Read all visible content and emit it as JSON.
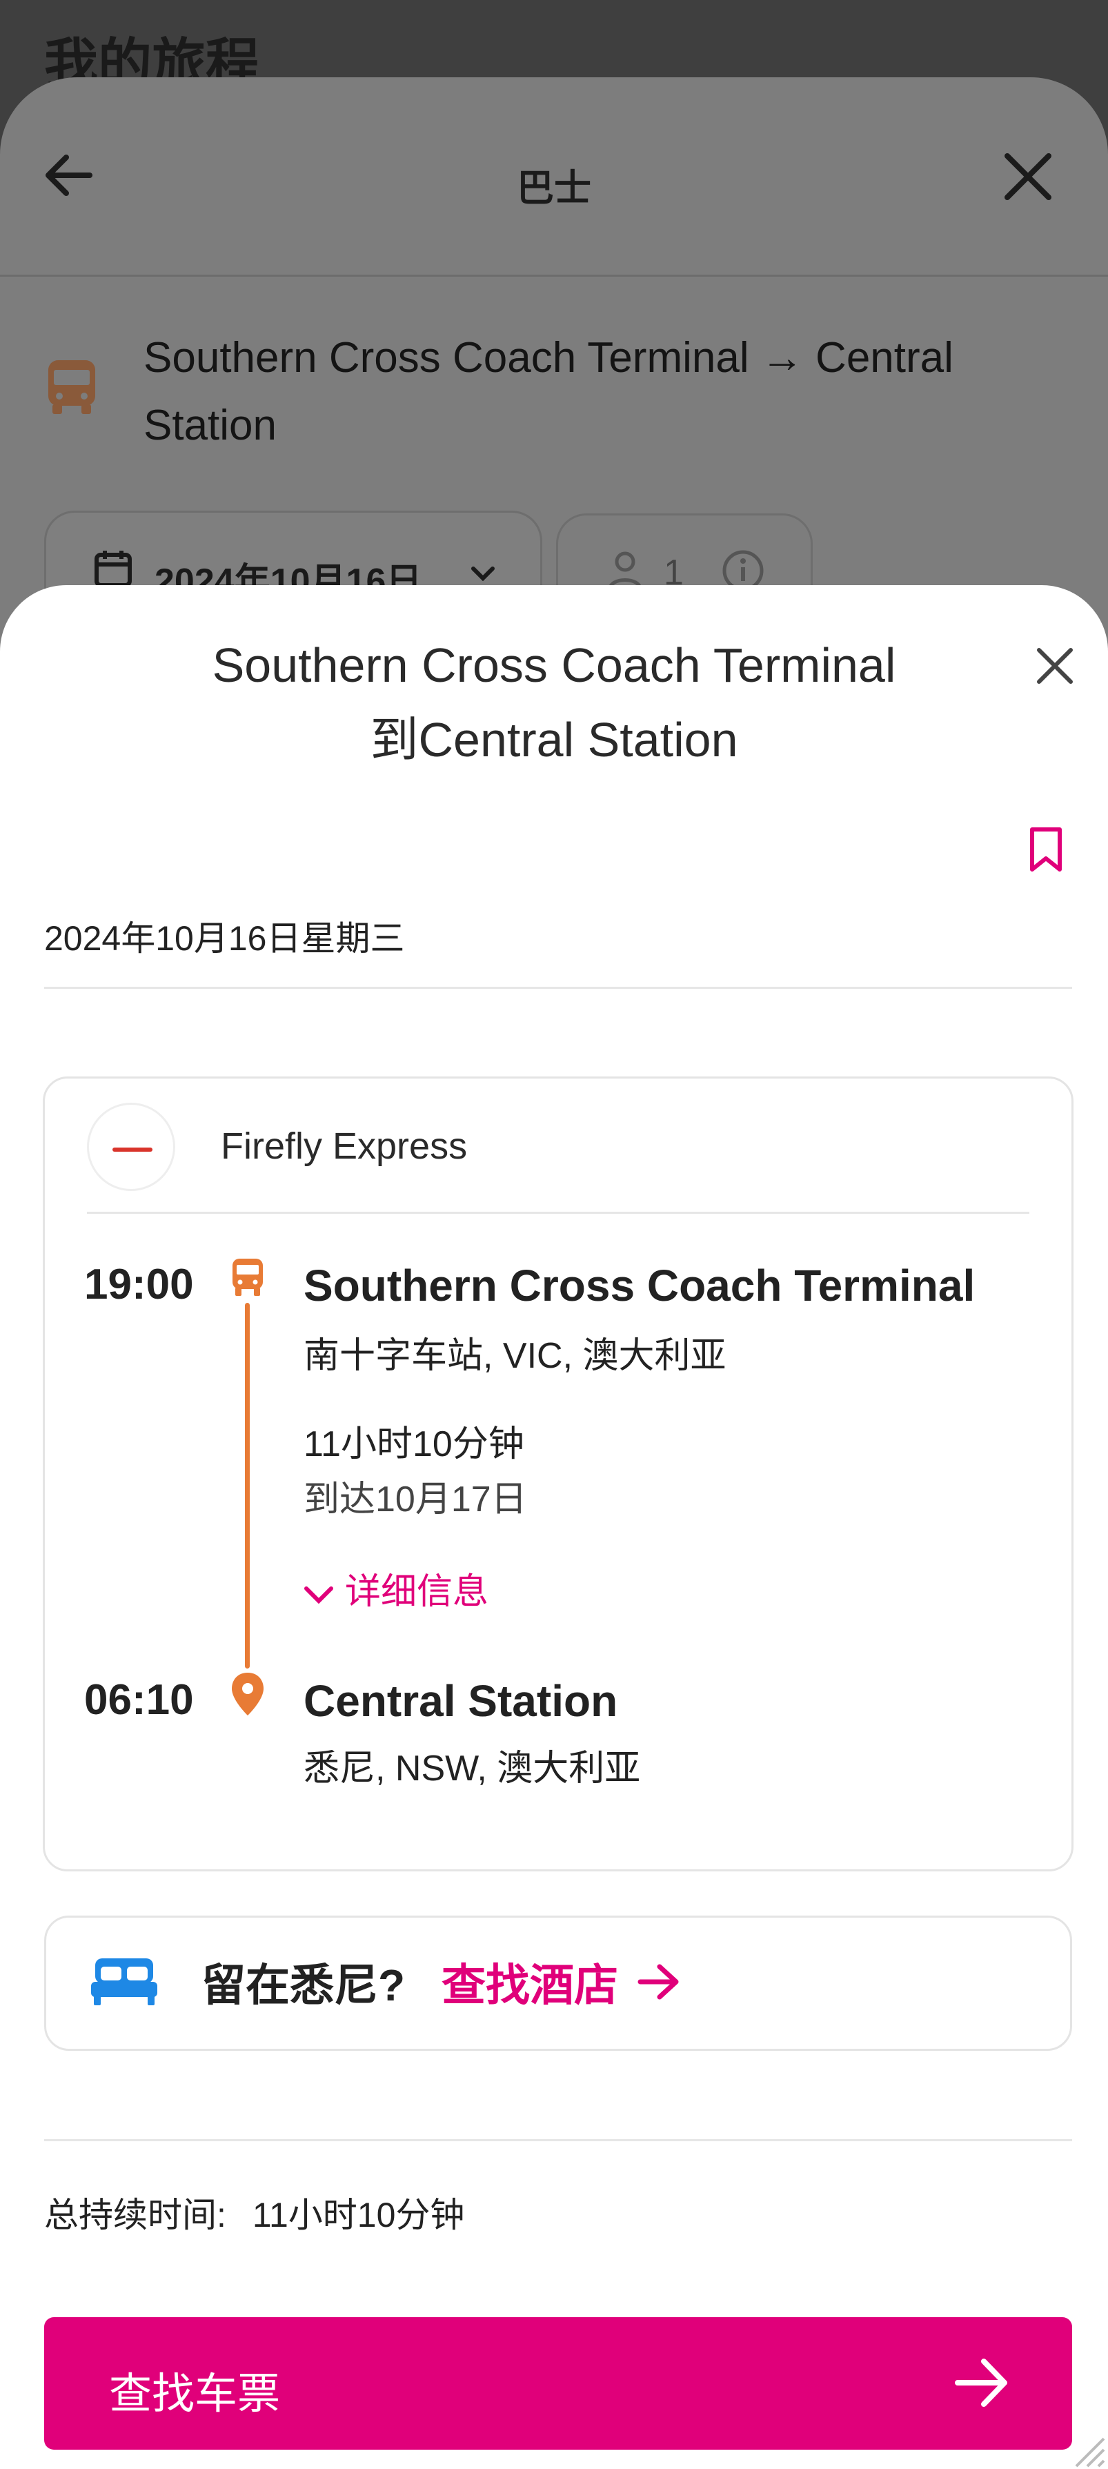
{
  "background": {
    "page_title": "我的旅程",
    "header_title": "巴士",
    "route": "Southern Cross Coach Terminal → Central Station",
    "date": "2024年10月16日",
    "passengers": "1"
  },
  "modal": {
    "title_line1": "Southern Cross Coach Terminal",
    "title_line2": "到Central Station",
    "date": "2024年10月16日星期三",
    "operator": "Firefly Express",
    "departure": {
      "time": "19:00",
      "stop": "Southern Cross Coach Terminal",
      "location": "南十字车站, VIC, 澳大利亚"
    },
    "duration": "11小时10分钟",
    "arrival_note": "到达10月17日",
    "details_label": "详细信息",
    "arrival": {
      "time": "06:10",
      "stop": "Central Station",
      "location": "悉尼, NSW, 澳大利亚"
    },
    "hotel_question": "留在悉尼?",
    "hotel_link": "查找酒店",
    "total_label": "总持续时间:",
    "total_value": "11小时10分钟",
    "cta_label": "查找车票"
  },
  "colors": {
    "accent": "#e0007a",
    "timeline": "#e87b35",
    "bed_icon": "#1e88e5"
  },
  "icons": [
    "back-arrow-icon",
    "close-icon",
    "bus-icon",
    "calendar-icon",
    "chevron-down-icon",
    "person-icon",
    "info-icon",
    "bookmark-icon",
    "location-pin-icon",
    "bed-icon",
    "arrow-right-icon"
  ]
}
